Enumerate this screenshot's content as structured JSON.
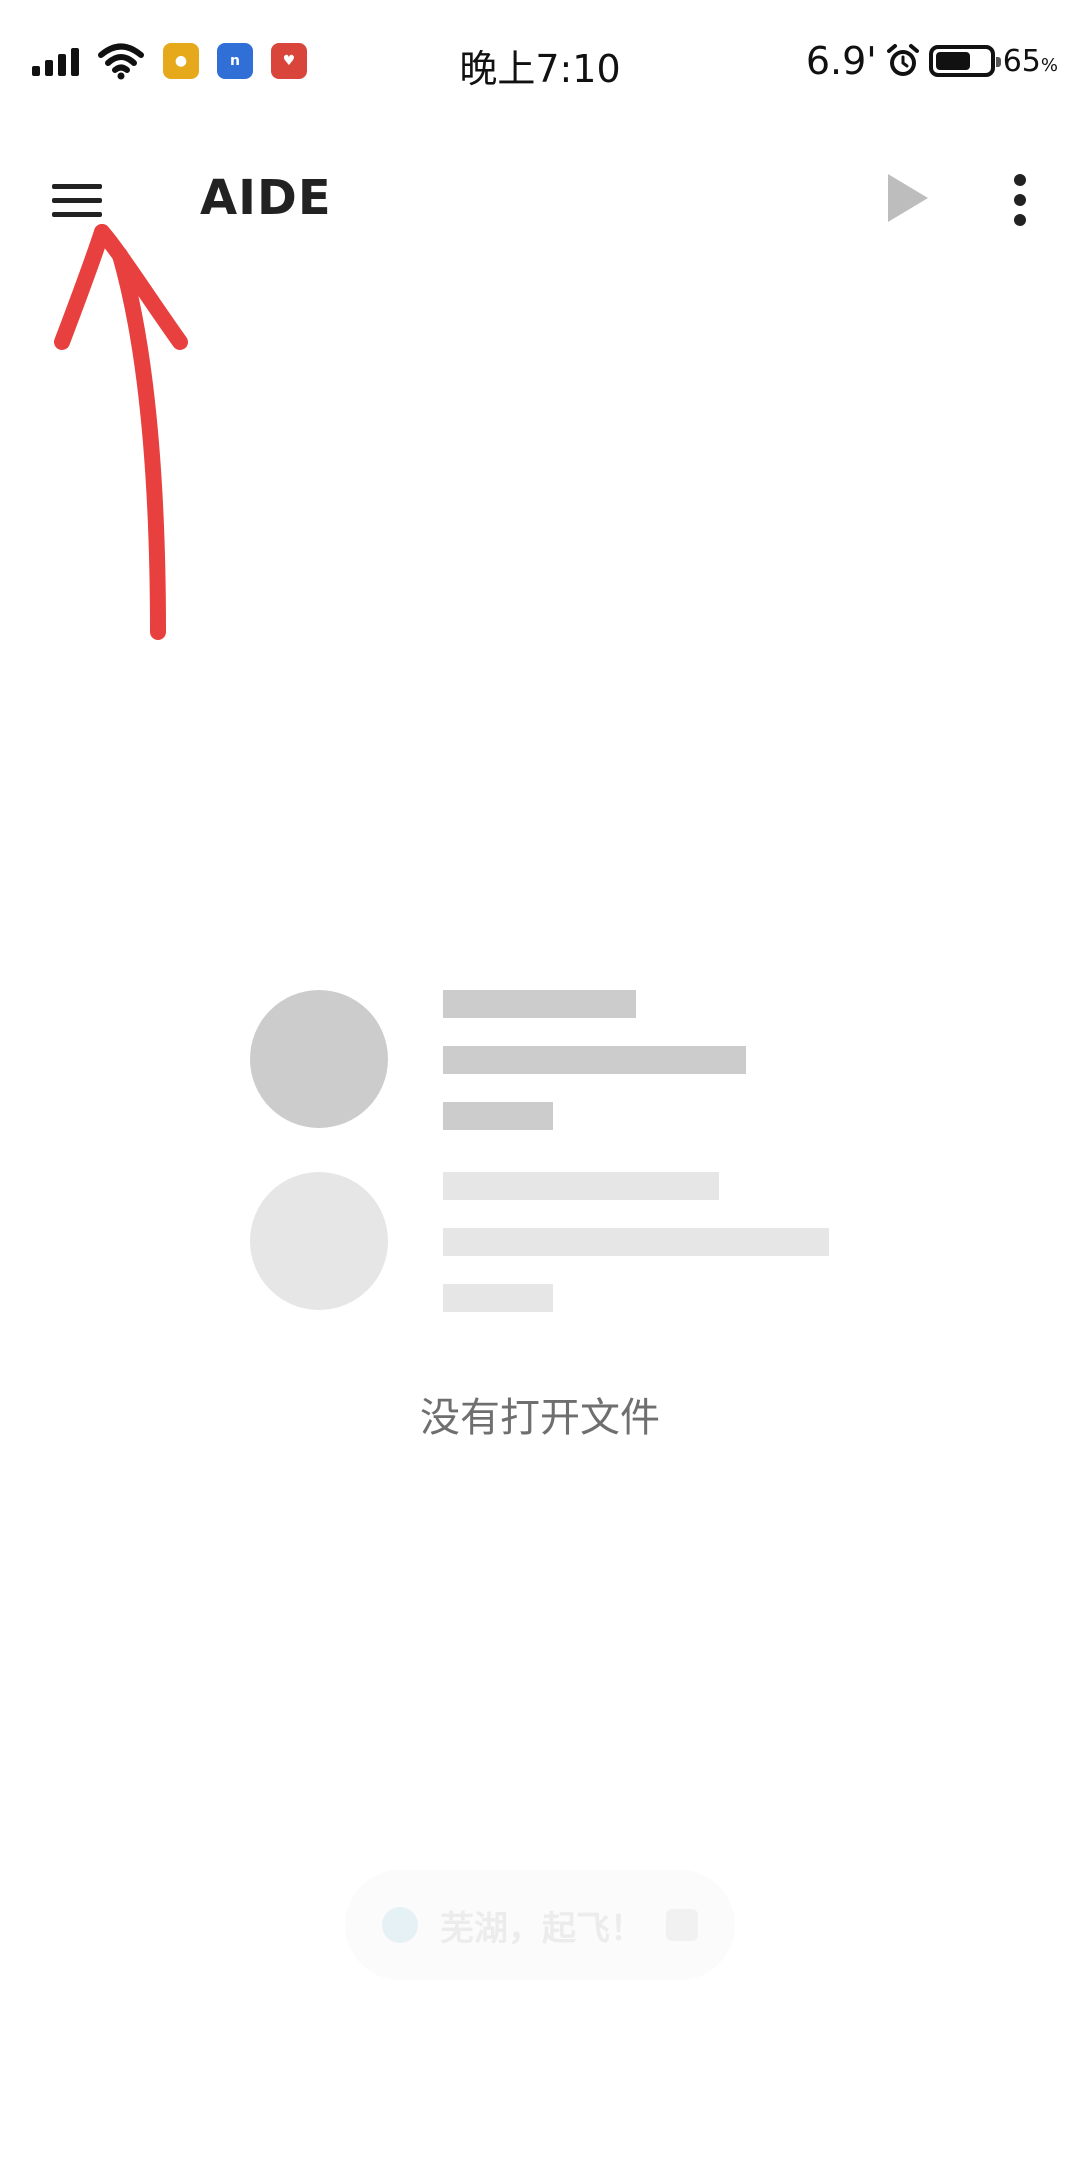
{
  "status_bar": {
    "time": "晚上7:10",
    "network_speed": "6.9'",
    "battery_level": "65",
    "battery_unit": "%",
    "battery_fraction": 0.65,
    "notification_icons": [
      "yellow-app-icon",
      "blue-app-icon",
      "red-app-icon"
    ]
  },
  "toolbar": {
    "title": "AIDE",
    "menu_icon": "hamburger-menu-icon",
    "run_icon": "play-icon",
    "overflow_icon": "more-vertical-icon"
  },
  "empty_state": {
    "message": "没有打开文件"
  },
  "toast": {
    "text": "芜湖，起飞！"
  },
  "annotation": {
    "type": "arrow",
    "color": "#e8403f",
    "points_to": "menu-button"
  },
  "colors": {
    "background": "#ffffff",
    "text_primary": "#222222",
    "empty_text": "#6f6f6f",
    "placeholder_dark": "#cccccc",
    "placeholder_light": "#e6e6e6",
    "run_icon": "#bdbdbd"
  }
}
